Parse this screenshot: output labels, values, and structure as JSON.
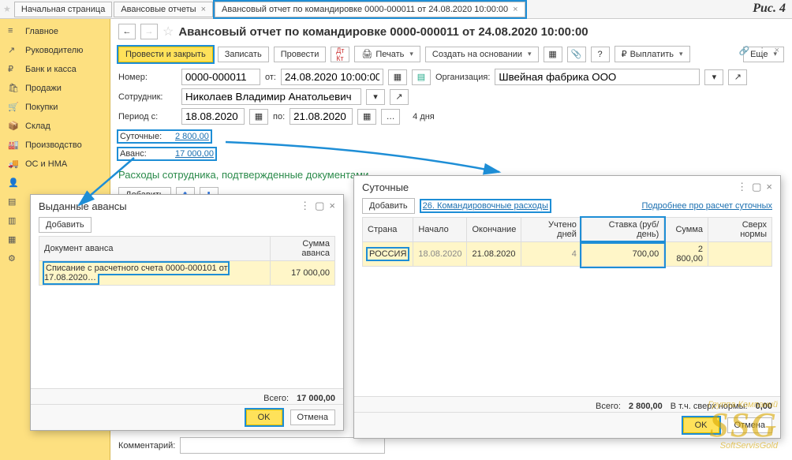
{
  "fig_label": "Рис. 4",
  "tabs": {
    "home": "Начальная страница",
    "t1": "Авансовые отчеты",
    "t2": "Авансовый отчет по командировке 0000-000011 от 24.08.2020 10:00:00"
  },
  "sidebar": {
    "items": [
      "Главное",
      "Руководителю",
      "Банк и касса",
      "Продажи",
      "Покупки",
      "Склад",
      "Производство",
      "ОС и НМА",
      "",
      "",
      "",
      "",
      ""
    ]
  },
  "title": "Авансовый отчет по командировке 0000-000011 от 24.08.2020 10:00:00",
  "toolbar": {
    "post_close": "Провести и закрыть",
    "save": "Записать",
    "post": "Провести",
    "print": "Печать",
    "create_based": "Создать на основании",
    "pay": "Выплатить",
    "more": "Еще"
  },
  "form": {
    "number_lbl": "Номер:",
    "number": "0000-000011",
    "from_lbl": "от:",
    "date": "24.08.2020 10:00:00",
    "org_lbl": "Организация:",
    "org": "Швейная фабрика ООО",
    "employee_lbl": "Сотрудник:",
    "employee": "Николаев Владимир Анатольевич",
    "period_from_lbl": "Период с:",
    "period_from": "18.08.2020",
    "period_to_lbl": "по:",
    "period_to": "21.08.2020",
    "days": "4 дня",
    "perdiem_lbl": "Суточные:",
    "perdiem_link": "2 800,00",
    "advance_lbl": "Аванс:",
    "advance_link": "17 000,00",
    "section_title": "Расходы сотрудника, подтвержденные документами",
    "add": "Добавить",
    "comment_lbl": "Комментарий:"
  },
  "popup_adv": {
    "title": "Выданные авансы",
    "add": "Добавить",
    "col_doc": "Документ аванса",
    "col_sum": "Сумма аванса",
    "row_doc": "Списание с расчетного счета 0000-000101 от 17.08.2020…",
    "row_sum": "17 000,00",
    "total_lbl": "Всего:",
    "total": "17 000,00",
    "ok": "OK",
    "cancel": "Отмена"
  },
  "popup_perdiem": {
    "title": "Суточные",
    "add": "Добавить",
    "link": "26. Командировочные расходы",
    "more_link": "Подробнее про расчет суточных",
    "cols": {
      "country": "Страна",
      "start": "Начало",
      "end": "Окончание",
      "days": "Учтено дней",
      "rate": "Ставка (руб/день)",
      "sum": "Сумма",
      "over": "Сверх нормы"
    },
    "row": {
      "country": "РОССИЯ",
      "start": "18.08.2020",
      "end": "21.08.2020",
      "days": "4",
      "rate": "700,00",
      "sum": "2 800,00",
      "over": ""
    },
    "total_lbl": "Всего:",
    "total": "2 800,00",
    "over_lbl": "В т.ч. сверх нормы:",
    "over_val": "0,00",
    "ok": "OK",
    "cancel": "Отмена"
  },
  "watermark": {
    "line1": "Группа Компаний",
    "big": "SSG",
    "line2": "SoftServisGold"
  }
}
